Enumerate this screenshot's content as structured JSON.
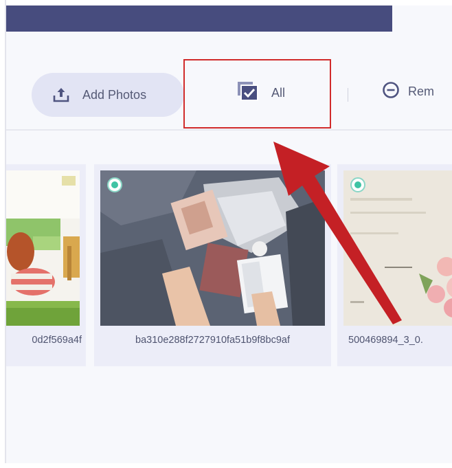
{
  "toolbar": {
    "add_photos_label": "Add Photos",
    "all_label": "All",
    "remove_label": "Rem"
  },
  "photos": [
    {
      "name": "0d2f569a4f"
    },
    {
      "name": "ba310e288f2727910fa51b9f8bc9af"
    },
    {
      "name": "500469894_3_0."
    }
  ],
  "colors": {
    "title_bar": "#474c7e",
    "selected_dot": "#3fc3a4",
    "highlight": "#d12a2a",
    "arrow": "#c42025"
  }
}
